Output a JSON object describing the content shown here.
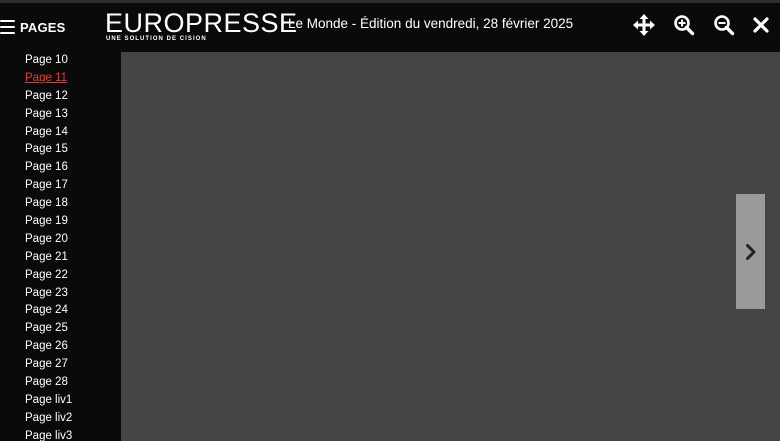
{
  "header": {
    "pages_label": "PAGES",
    "logo_main": "EUROPRESSE",
    "logo_sub": "UNE SOLUTION DE CISION",
    "edition_text": "Le Monde - Édition du vendredi, 28 février 2025"
  },
  "toolbar": {
    "icons": [
      "move-icon",
      "zoom-in-icon",
      "zoom-out-icon",
      "close-icon"
    ]
  },
  "sidebar": {
    "active_page": "Page 11",
    "pages": [
      "Page 10",
      "Page 11",
      "Page 12",
      "Page 13",
      "Page 14",
      "Page 15",
      "Page 16",
      "Page 17",
      "Page 18",
      "Page 19",
      "Page 20",
      "Page 21",
      "Page 22",
      "Page 23",
      "Page 24",
      "Page 25",
      "Page 26",
      "Page 27",
      "Page 28",
      "Page liv1",
      "Page liv2",
      "Page liv3"
    ]
  },
  "viewer": {
    "next_icon": "chevron-right-icon"
  },
  "colors": {
    "header_bg": "#0a0a0a",
    "viewer_bg": "#454545",
    "active_link": "#e03f30",
    "next_button_bg": "#9a9a9a"
  }
}
